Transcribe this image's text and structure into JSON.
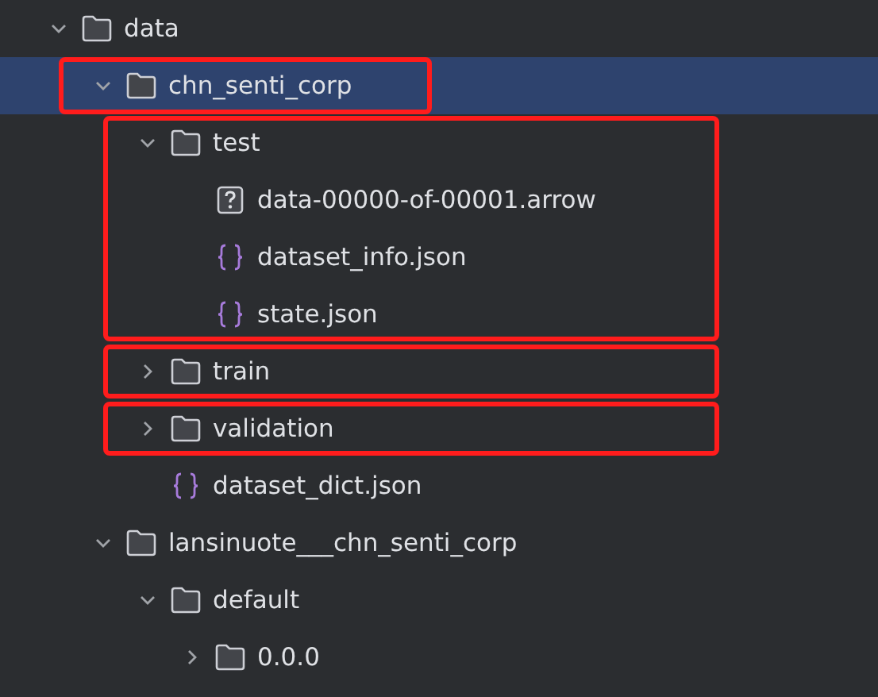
{
  "tree": [
    {
      "name": "data",
      "kind": "folder",
      "expanded": true,
      "selected": false,
      "children": [
        {
          "name": "chn_senti_corp",
          "kind": "folder",
          "expanded": true,
          "selected": true,
          "boxed_name": true,
          "children": [
            {
              "name": "test",
              "kind": "folder",
              "expanded": true,
              "selected": false,
              "boxed": true,
              "children": [
                {
                  "name": "data-00000-of-00001.arrow",
                  "kind": "unknown_file",
                  "selected": false
                },
                {
                  "name": "dataset_info.json",
                  "kind": "json_file",
                  "selected": false
                },
                {
                  "name": "state.json",
                  "kind": "json_file",
                  "selected": false
                }
              ]
            },
            {
              "name": "train",
              "kind": "folder",
              "expanded": false,
              "selected": false,
              "boxed": true
            },
            {
              "name": "validation",
              "kind": "folder",
              "expanded": false,
              "selected": false,
              "boxed": true
            },
            {
              "name": "dataset_dict.json",
              "kind": "json_file",
              "selected": false
            }
          ]
        },
        {
          "name": "lansinuote___chn_senti_corp",
          "kind": "folder",
          "expanded": true,
          "selected": false,
          "children": [
            {
              "name": "default",
              "kind": "folder",
              "expanded": true,
              "selected": false,
              "children": [
                {
                  "name": "0.0.0",
                  "kind": "folder",
                  "expanded": false,
                  "selected": false
                }
              ]
            }
          ]
        }
      ]
    }
  ]
}
